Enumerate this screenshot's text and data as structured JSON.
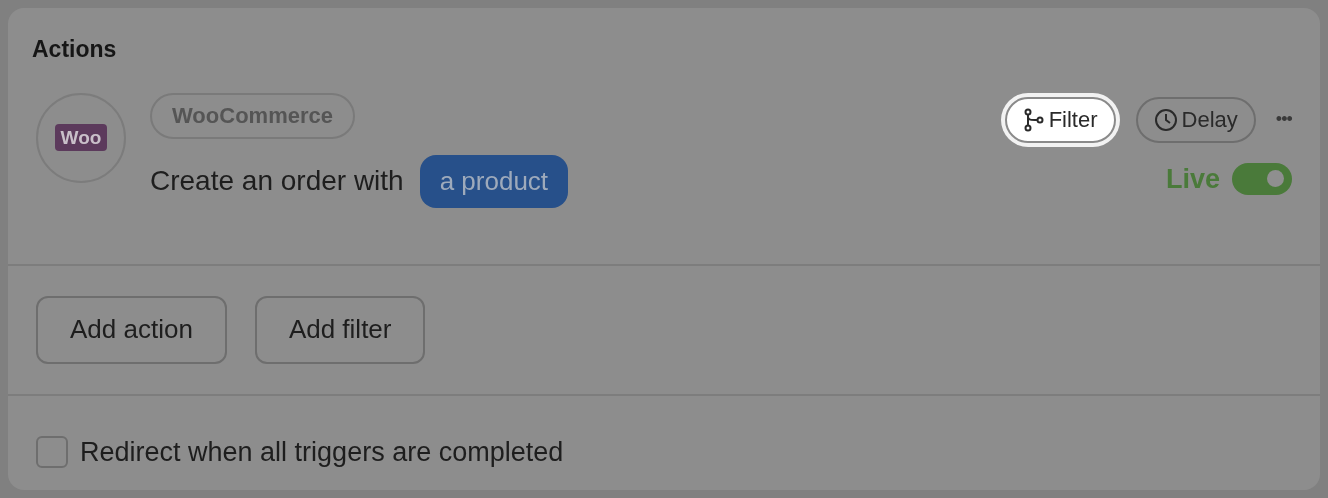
{
  "title": "Actions",
  "action": {
    "logo_text": "Woo",
    "app": "WooCommerce",
    "description": "Create an order with",
    "token": "a product",
    "filter_button": {
      "label": "Filter",
      "highlighted": true
    },
    "delay_button": {
      "label": "Delay",
      "highlighted": false
    },
    "more": "•••",
    "status": {
      "label": "Live",
      "on": true
    }
  },
  "buttons": [
    "Add action",
    "Add filter"
  ],
  "redirect": {
    "label": "Redirect when all triggers are completed",
    "checked": false
  }
}
